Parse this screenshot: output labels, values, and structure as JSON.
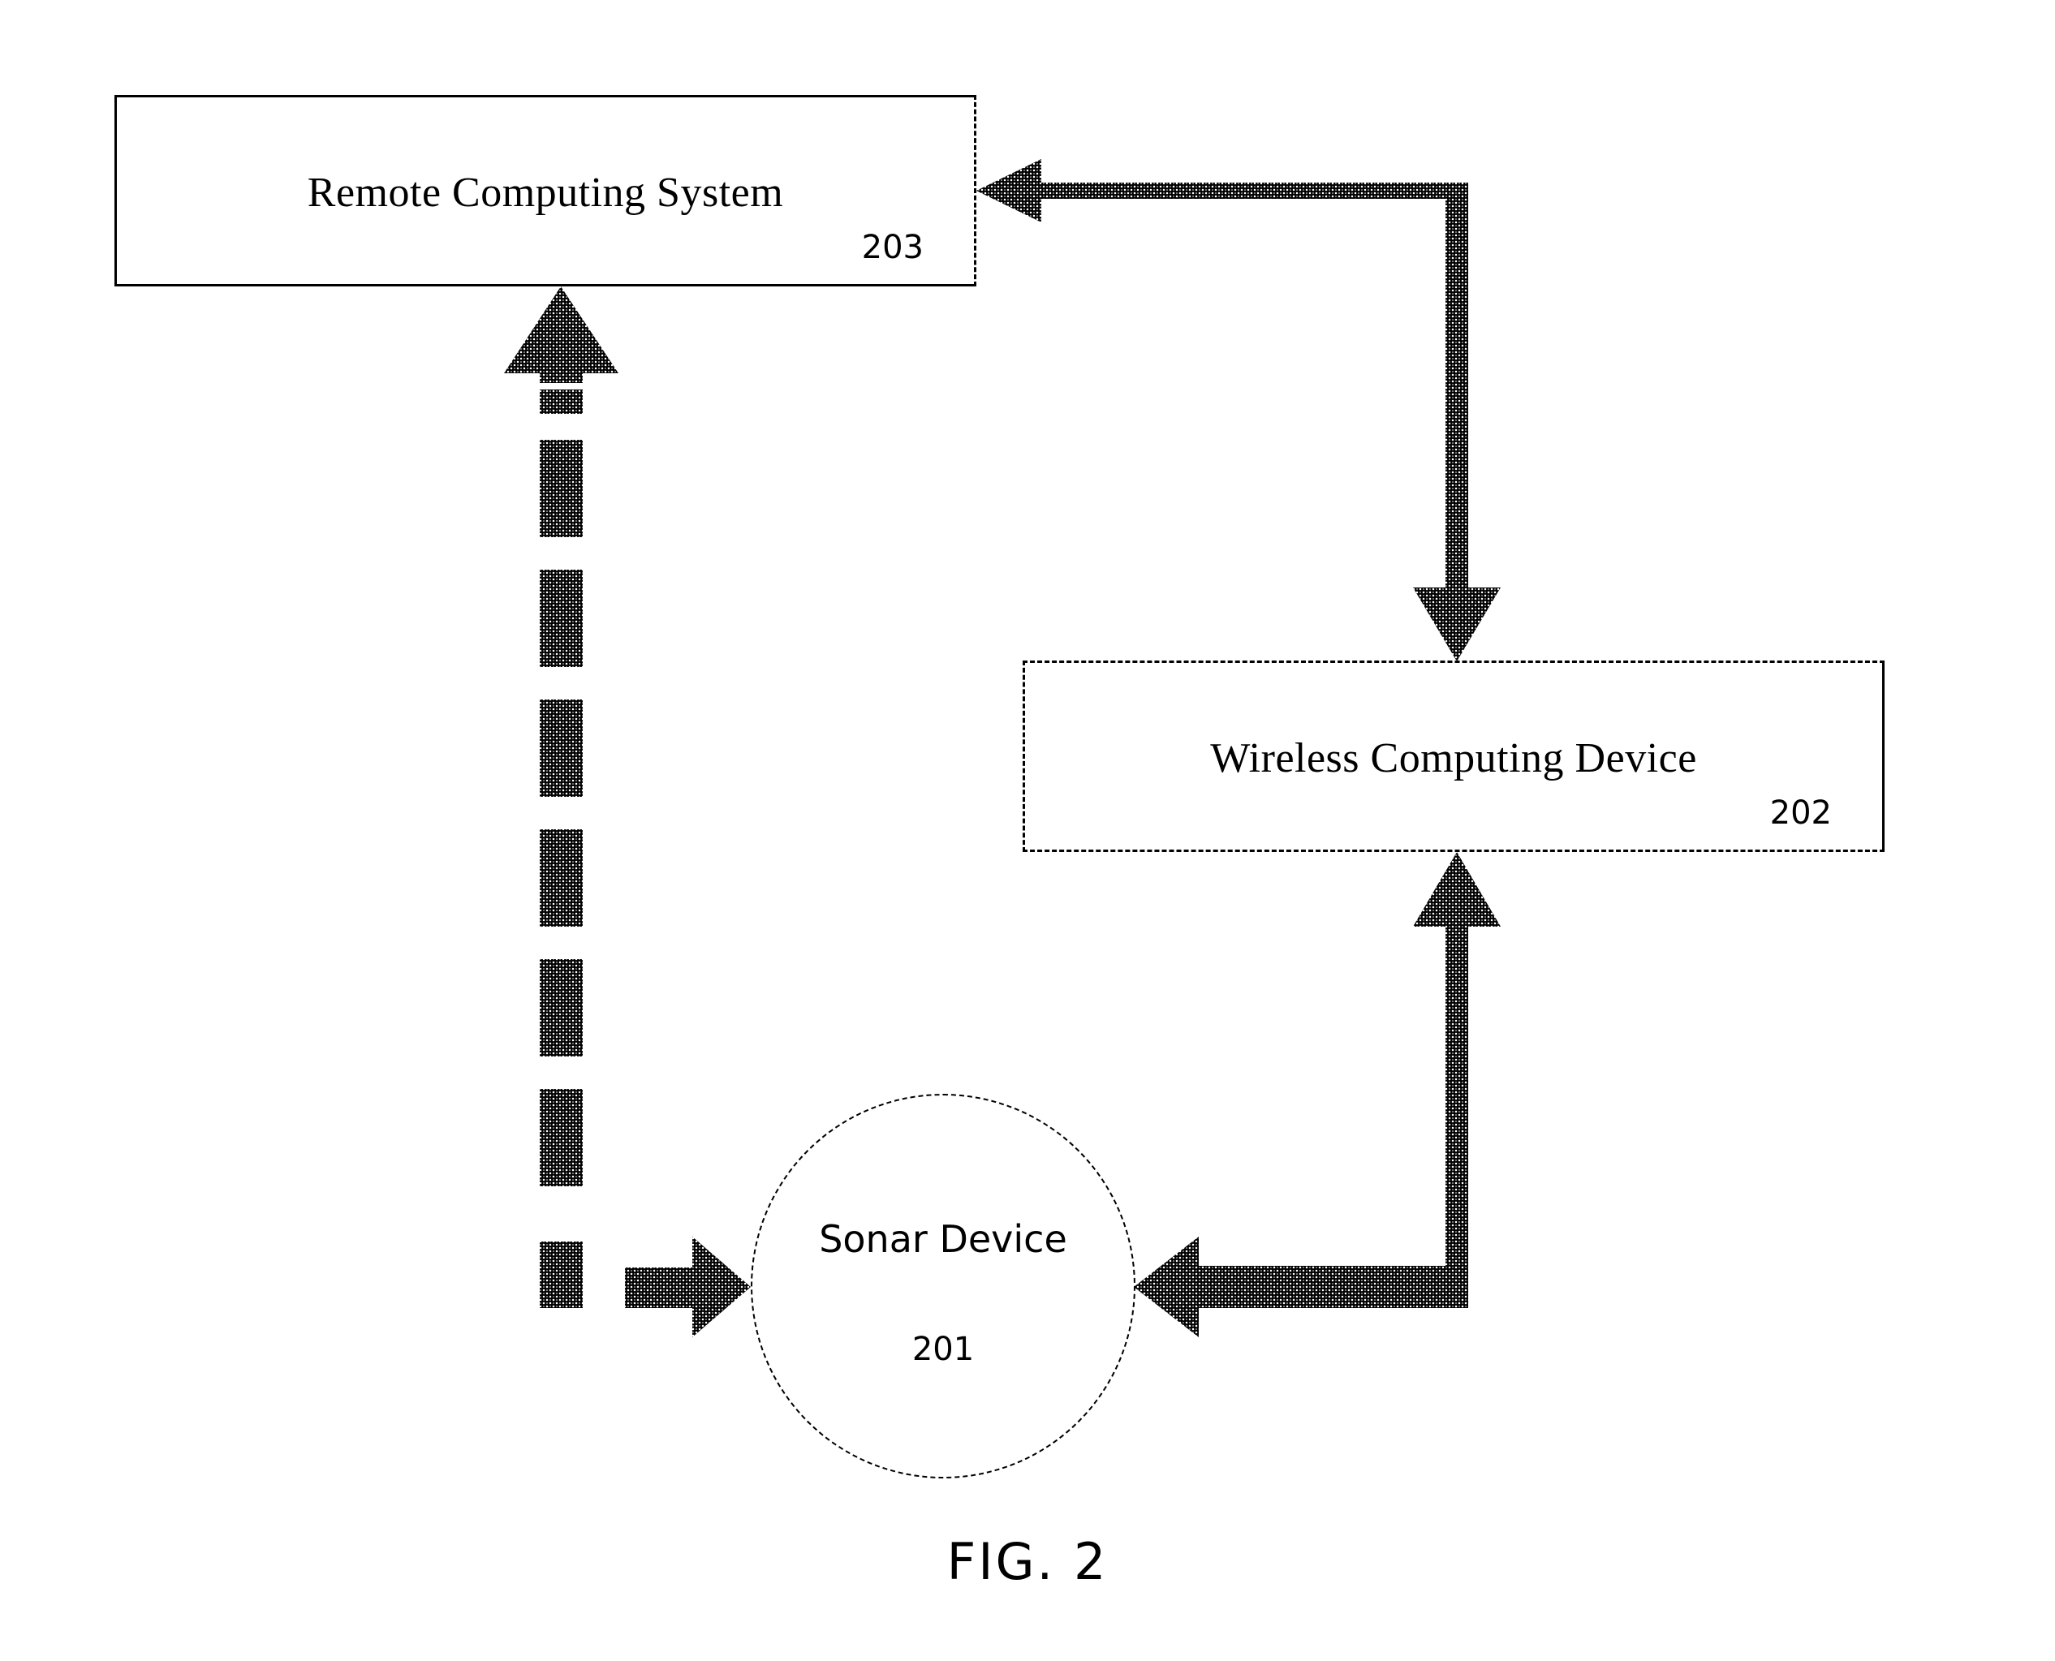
{
  "figure": {
    "caption": "FIG. 2",
    "nodes": {
      "remote_computing_system": {
        "title": "Remote Computing System",
        "ref": "203",
        "shape": "rectangle",
        "border_style": "solid-with-dashed-right"
      },
      "wireless_computing_device": {
        "title": "Wireless Computing Device",
        "ref": "202",
        "shape": "rectangle",
        "border_style": "dashed-with-solid-right"
      },
      "sonar_device": {
        "title": "Sonar Device",
        "ref": "201",
        "shape": "circle",
        "border_style": "dashed"
      }
    },
    "connectors": [
      {
        "name": "wireless-to-remote",
        "from": "wireless_computing_device",
        "to": "remote_computing_system",
        "style": "solid",
        "direction": "up-then-left"
      },
      {
        "name": "remote-to-wireless",
        "from": "remote_computing_system",
        "to": "wireless_computing_device",
        "style": "solid",
        "direction": "right-then-down"
      },
      {
        "name": "sonar-to-wireless",
        "from": "sonar_device",
        "to": "wireless_computing_device",
        "style": "solid",
        "direction": "right-then-up"
      },
      {
        "name": "wireless-to-sonar",
        "from": "wireless_computing_device",
        "to": "sonar_device",
        "style": "solid",
        "direction": "down-then-left"
      },
      {
        "name": "sonar-to-remote",
        "from": "sonar_device",
        "to": "remote_computing_system",
        "style": "dashed",
        "direction": "left-then-up"
      }
    ],
    "colors": {
      "stroke": "#000000",
      "background": "#ffffff"
    }
  }
}
